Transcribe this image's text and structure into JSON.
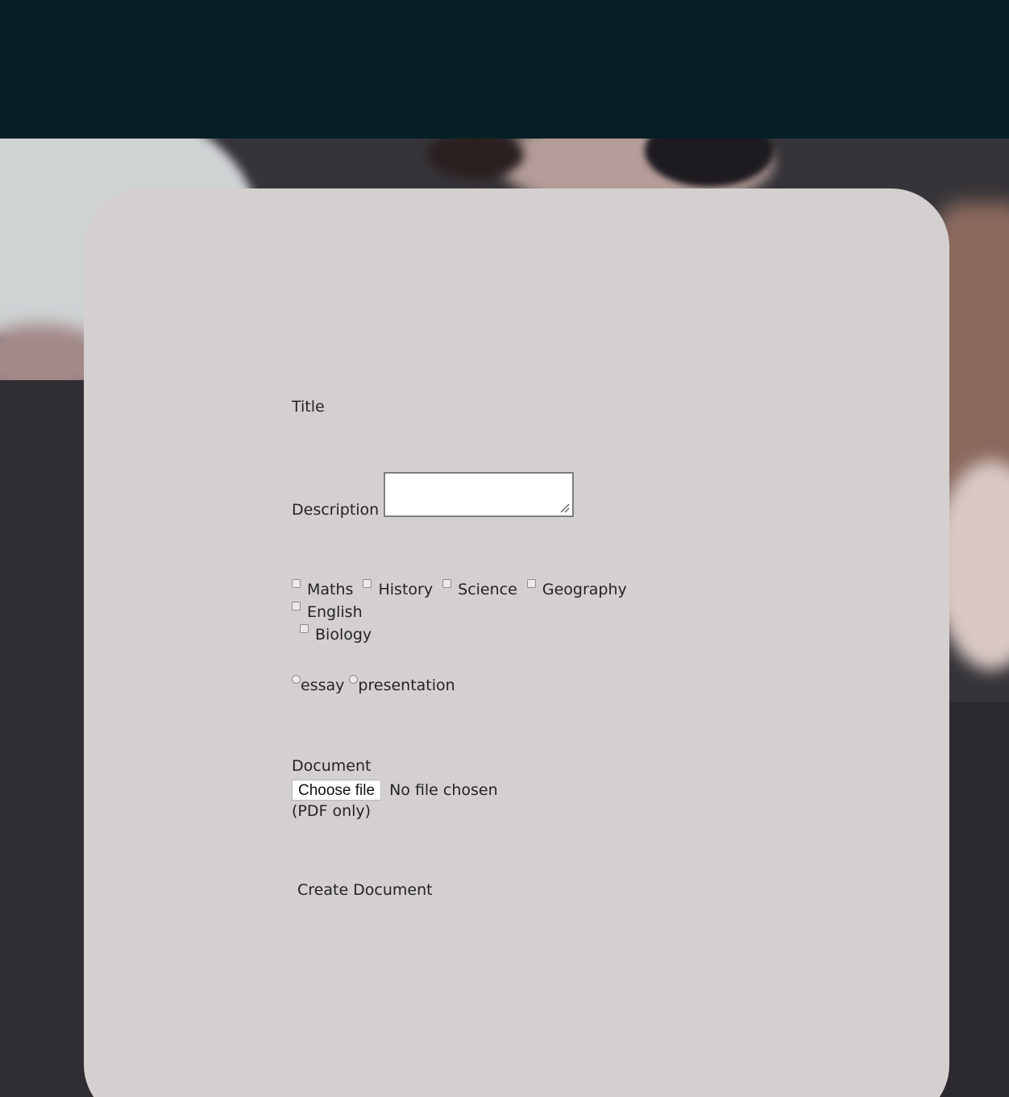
{
  "form": {
    "title_label": "Title",
    "description_label": "Description",
    "description_value": "",
    "subjects": [
      {
        "label": "Maths",
        "checked": false
      },
      {
        "label": "History",
        "checked": false
      },
      {
        "label": "Science",
        "checked": false
      },
      {
        "label": "Geography",
        "checked": false
      },
      {
        "label": "English",
        "checked": false
      },
      {
        "label": "Biology",
        "checked": false
      }
    ],
    "types": [
      {
        "label": "essay",
        "selected": false
      },
      {
        "label": "presentation",
        "selected": false
      }
    ],
    "document_label": "Document",
    "choose_file_label": "Choose file",
    "file_status": "No file chosen",
    "file_note": "(PDF only)",
    "submit_label": "Create Document"
  },
  "colors": {
    "header": "#061f25",
    "card": "#d4d0cf",
    "text": "#232326"
  }
}
